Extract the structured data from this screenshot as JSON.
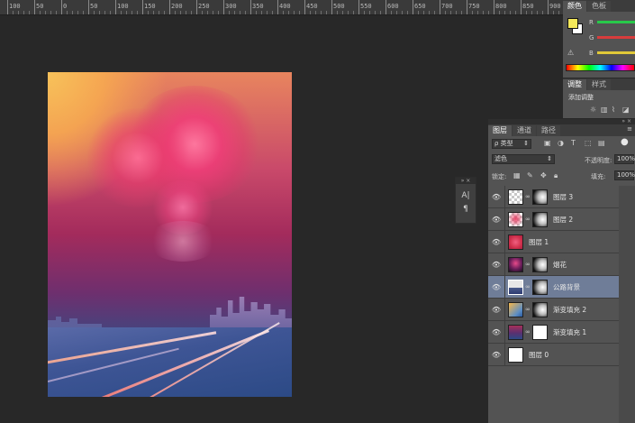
{
  "ruler": {
    "ticks": [
      "100",
      "50",
      "0",
      "50",
      "100",
      "150",
      "200",
      "250",
      "300",
      "350",
      "400",
      "450",
      "500",
      "550",
      "600",
      "650",
      "700",
      "750",
      "800",
      "850",
      "900"
    ]
  },
  "color_panel": {
    "tabs": [
      "颜色",
      "色板"
    ],
    "channels": [
      "R",
      "G",
      "B"
    ],
    "foreground_color": "#f4e85a",
    "background_color": "#ffffff",
    "bar_colors": [
      "#28c84a",
      "#d83c3c",
      "#e0c838"
    ]
  },
  "adjust_panel": {
    "tabs": [
      "调整",
      "样式"
    ],
    "add_label": "添加调整",
    "icons": [
      "sun-icon",
      "levels-icon",
      "curves-icon",
      "exposure-icon"
    ]
  },
  "layers_panel": {
    "tabs": [
      "图层",
      "通道",
      "路径"
    ],
    "filter_label": "ρ 类型",
    "blend_mode": "滤色",
    "opacity_label": "不透明度:",
    "opacity_value": "100%",
    "lock_label": "锁定:",
    "fill_label": "填充:",
    "fill_value": "100%",
    "layers": [
      {
        "name": "图层 3",
        "thumb": "checker",
        "mask": true,
        "selected": false
      },
      {
        "name": "图层 2",
        "thumb": "checker-red",
        "mask": true,
        "selected": false
      },
      {
        "name": "图层 1",
        "thumb": "red",
        "mask": false,
        "selected": false
      },
      {
        "name": "烟花",
        "thumb": "fireworks",
        "mask": true,
        "selected": false
      },
      {
        "name": "公路背景",
        "thumb": "city",
        "mask": true,
        "selected": true
      },
      {
        "name": "渐变填充 2",
        "thumb": "gradient-orange",
        "mask": true,
        "selected": false
      },
      {
        "name": "渐变填充 1",
        "thumb": "gradient-purple",
        "mask": true,
        "selected": false
      },
      {
        "name": "图层 0",
        "thumb": "white",
        "mask": false,
        "selected": false
      }
    ]
  },
  "mini_dock": {
    "tools": [
      "character-icon",
      "paragraph-icon"
    ],
    "labels": [
      "A|",
      "¶"
    ]
  }
}
